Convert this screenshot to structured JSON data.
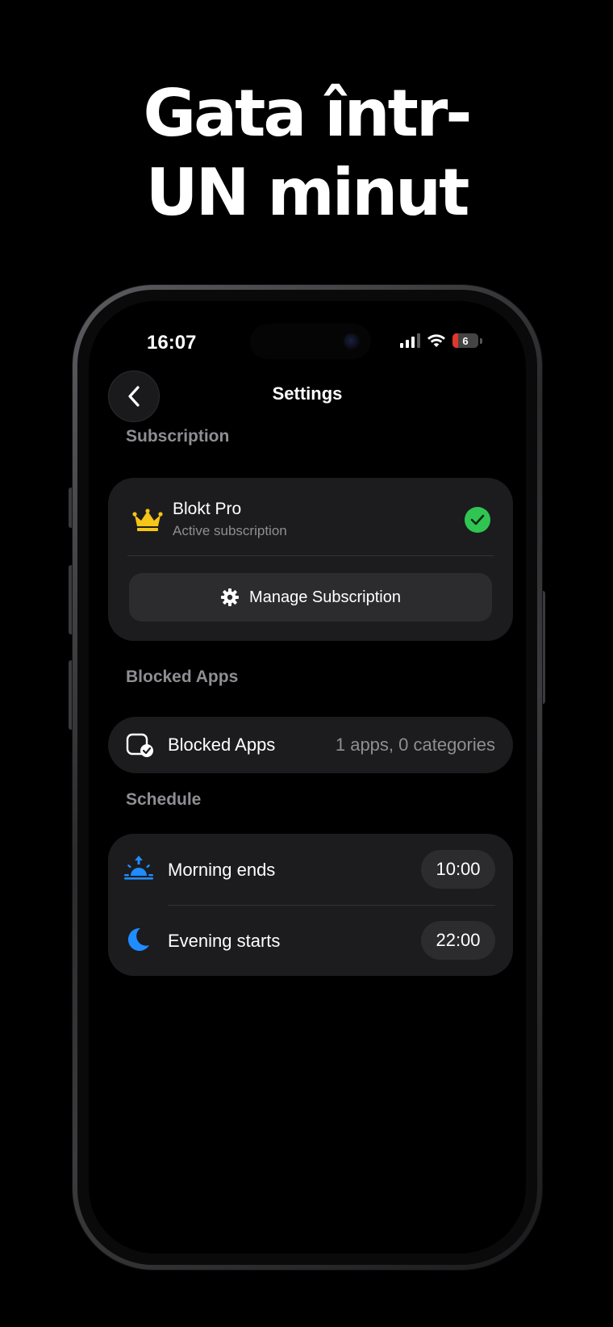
{
  "headline": {
    "line1": "Gata într-",
    "line2": "UN minut"
  },
  "status_bar": {
    "time": "16:07",
    "battery_level": "6"
  },
  "nav": {
    "title": "Settings"
  },
  "subscription": {
    "section_label": "Subscription",
    "plan_name": "Blokt Pro",
    "plan_status": "Active subscription",
    "manage_label": "Manage Subscription"
  },
  "blocked_apps": {
    "section_label": "Blocked Apps",
    "row_label": "Blocked Apps",
    "row_value": "1 apps, 0 categories"
  },
  "schedule": {
    "section_label": "Schedule",
    "items": [
      {
        "label": "Morning ends",
        "time": "10:00",
        "icon": "sunrise-icon"
      },
      {
        "label": "Evening starts",
        "time": "22:00",
        "icon": "moon-icon"
      }
    ]
  },
  "colors": {
    "accent_blue": "#1f8cff",
    "crown_yellow": "#f5c518",
    "check_green": "#30c552",
    "card_bg": "#1c1c1e",
    "secondary_text": "#8e8e93"
  }
}
